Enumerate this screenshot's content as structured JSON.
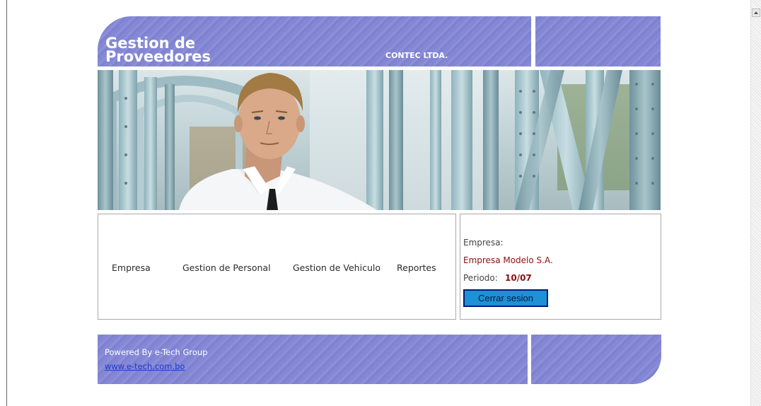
{
  "header": {
    "title": "Gestion de Proveedores",
    "company": "CONTEC LTDA."
  },
  "banner": {
    "image": "man-on-steel-bridge-photo"
  },
  "nav": {
    "items": [
      {
        "label": "Empresa"
      },
      {
        "label": "Gestion de Personal"
      },
      {
        "label": "Gestion de Vehiculo"
      },
      {
        "label": "Reportes"
      }
    ]
  },
  "info": {
    "empresa_label": "Empresa:",
    "empresa_value": "Empresa Modelo S.A.",
    "periodo_label": "Periodo:",
    "periodo_value": "10/07",
    "logout_label": "Cerrar sesion"
  },
  "footer": {
    "powered": "Powered By e-Tech Group",
    "link": "www.e-tech.com.bo"
  },
  "colors": {
    "brand_purple": "#8487d6",
    "accent_red": "#8b1010",
    "button_blue": "#1e90d6",
    "link_blue": "#1a3cc9"
  },
  "icons": [
    "scroll-up-arrow-icon"
  ]
}
